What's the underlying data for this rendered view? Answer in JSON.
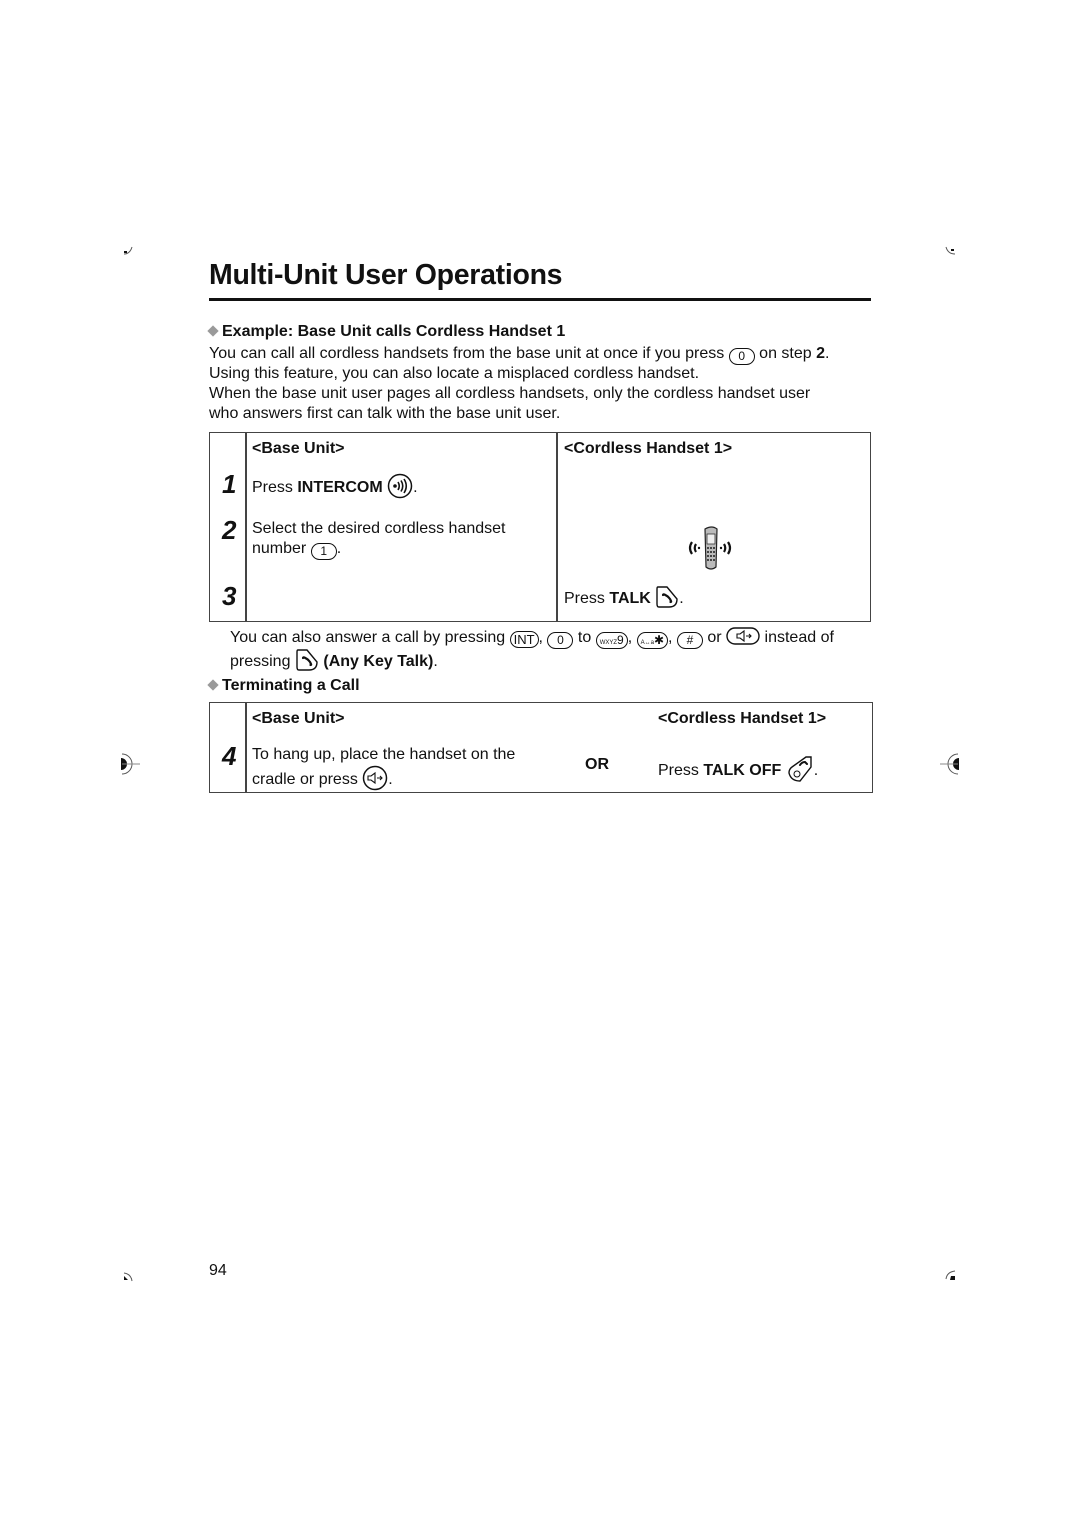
{
  "page": {
    "title": "Multi-Unit User Operations",
    "page_number": "94"
  },
  "example_section": {
    "heading": "Example: Base Unit calls Cordless Handset 1",
    "para1_a": "You can call all cordless handsets from the base unit at once if you press",
    "para1_key": "0",
    "para1_b": "on step",
    "para1_step": "2",
    "para1_c": ".",
    "para2": "Using this feature, you can also locate a misplaced cordless handset.",
    "para3": "When the base unit user pages all cordless handsets, only the cordless handset user",
    "para4": "who answers first can talk with the base unit user."
  },
  "table1": {
    "col_base": "<Base Unit>",
    "col_handset": "<Cordless Handset 1>",
    "steps": [
      {
        "number": "1",
        "base_prefix": "Press",
        "base_bold": "INTERCOM",
        "base_icon": "intercom-button-icon",
        "base_suffix": "."
      },
      {
        "number": "2",
        "base_line1": "Select the desired cordless handset",
        "base_line2_prefix": "number",
        "base_key": "1",
        "base_suffix": "."
      },
      {
        "number": "3",
        "handset_prefix": "Press",
        "handset_bold": "TALK",
        "handset_icon": "talk-button-icon",
        "handset_suffix": "."
      }
    ],
    "ringing_icon": "ringing-handset-icon"
  },
  "note": {
    "line1_a": "You can also answer a call by pressing",
    "keys": [
      "INT",
      "0",
      "WXYZ9",
      "*",
      "#",
      "speaker"
    ],
    "key_labels": {
      "int": "INT",
      "zero": "0",
      "nine": "9",
      "nine_small": "WXYZ",
      "star": "✱",
      "star_small": "A↔a",
      "hash": "#"
    },
    "sep_comma": ",",
    "to": "to",
    "or": "or",
    "line1_end": "instead of",
    "line2_a": "pressing",
    "line2_bold": "(Any Key Talk)",
    "line2_end": "."
  },
  "terminate_section": {
    "heading": "Terminating a Call",
    "col_base": "<Base Unit>",
    "col_handset": "<Cordless Handset 1>",
    "step_number": "4",
    "base_line1": "To hang up, place the handset on the",
    "base_line2": "cradle or press",
    "base_suffix": ".",
    "or_label": "OR",
    "handset_prefix": "Press",
    "handset_bold": "TALK OFF",
    "handset_suffix": "."
  }
}
